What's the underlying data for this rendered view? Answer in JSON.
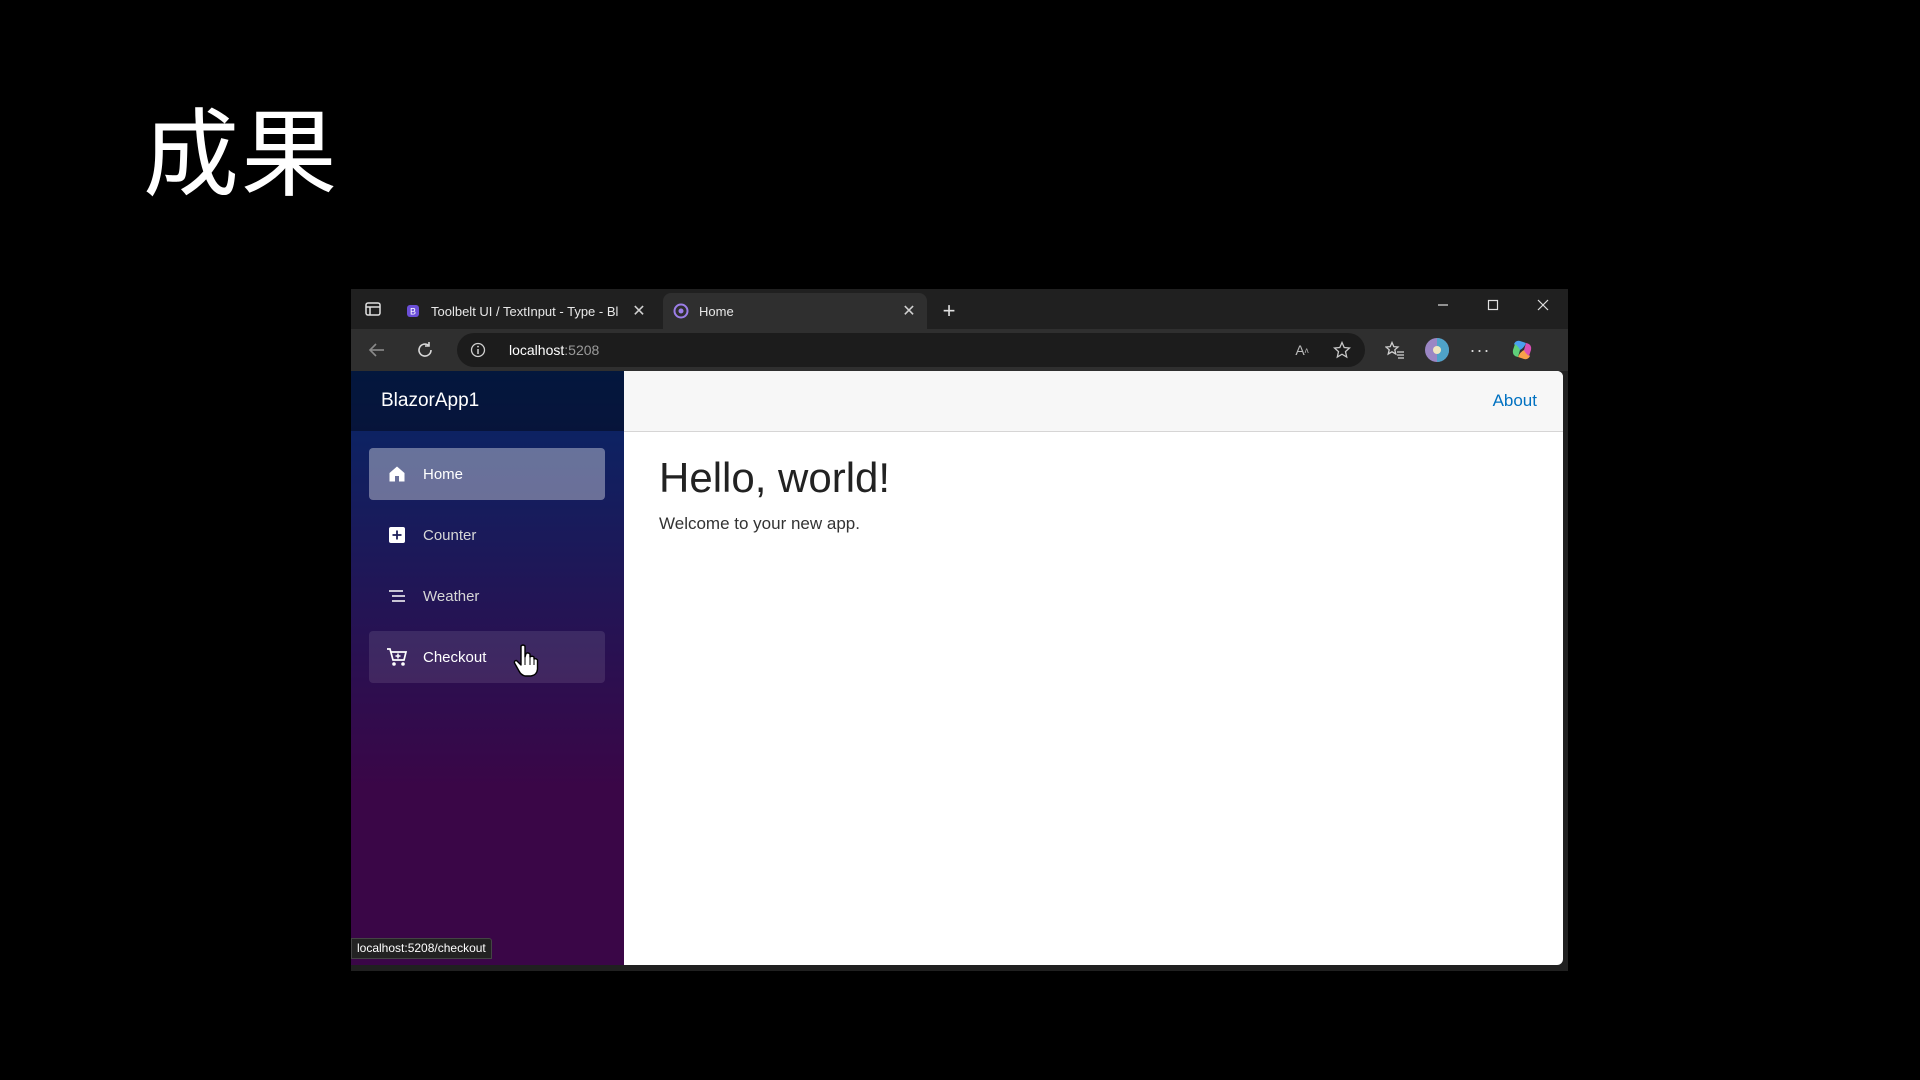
{
  "slide": {
    "title": "成果"
  },
  "browser": {
    "tabs": [
      {
        "title": "Toolbelt UI / TextInput - Type - Bl",
        "active": false
      },
      {
        "title": "Home",
        "active": true
      }
    ],
    "address": {
      "host": "localhost",
      "port": ":5208"
    },
    "status_url": "localhost:5208/checkout"
  },
  "app": {
    "brand": "BlazorApp1",
    "nav": [
      {
        "label": "Home",
        "icon": "home-icon",
        "state": "active"
      },
      {
        "label": "Counter",
        "icon": "plus-square-icon",
        "state": "normal"
      },
      {
        "label": "Weather",
        "icon": "list-icon",
        "state": "normal"
      },
      {
        "label": "Checkout",
        "icon": "cart-icon",
        "state": "hover"
      }
    ],
    "top_link": "About",
    "heading": "Hello, world!",
    "welcome": "Welcome to your new app."
  },
  "colors": {
    "sidebar_top": "#052767",
    "sidebar_bottom": "#3a0647",
    "link": "#0071c1",
    "browser_chrome": "#202020"
  }
}
